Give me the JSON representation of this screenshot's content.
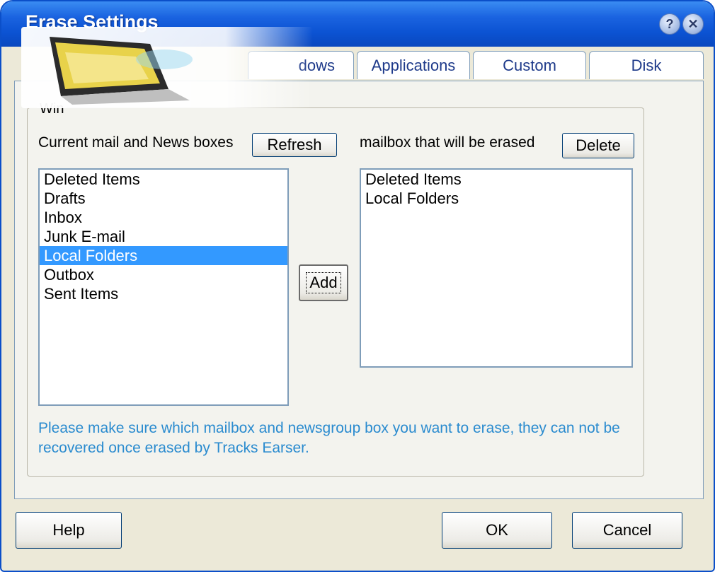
{
  "window": {
    "title": "Erase Settings"
  },
  "titlebar_buttons": {
    "help": "?",
    "close": "✕"
  },
  "tabs": [
    {
      "label": "dows"
    },
    {
      "label": "Applications"
    },
    {
      "label": "Custom"
    },
    {
      "label": "Disk"
    }
  ],
  "group": {
    "label": "Win"
  },
  "left": {
    "label": "Current mail and News boxes",
    "refresh": "Refresh",
    "items": [
      "Deleted Items",
      "Drafts",
      "Inbox",
      "Junk E-mail",
      "Local Folders",
      "Outbox",
      "Sent Items"
    ],
    "selected": "Local Folders"
  },
  "add_button": "Add",
  "right": {
    "label": "mailbox that will be erased",
    "delete": "Delete",
    "items": [
      "Deleted Items",
      "Local Folders"
    ]
  },
  "notice": "Please make sure which mailbox and newsgroup box you want to erase, they can not be recovered once erased by Tracks Earser.",
  "footer": {
    "help": "Help",
    "ok": "OK",
    "cancel": "Cancel"
  },
  "colors": {
    "titlebar": "#0b52d2",
    "selection": "#3399ff",
    "notice": "#2a8bcf",
    "tab_text": "#1e3a8a"
  }
}
